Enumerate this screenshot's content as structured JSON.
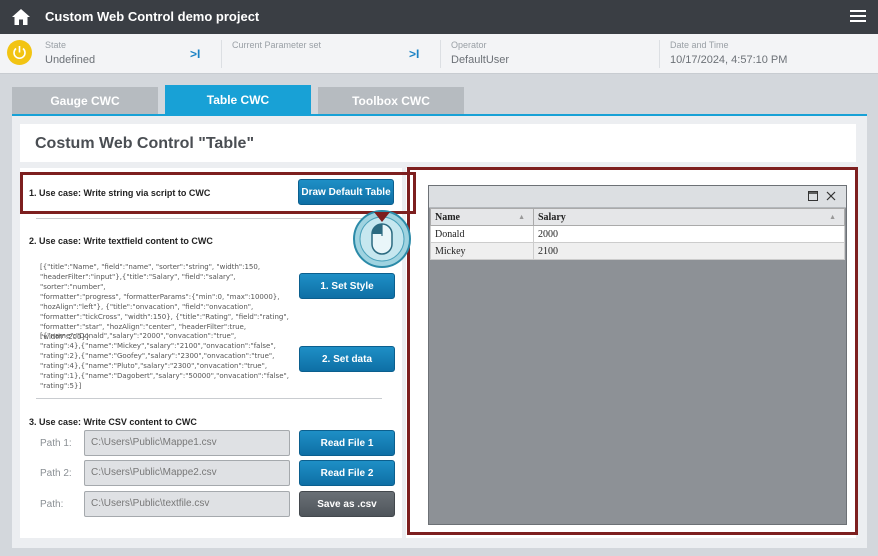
{
  "titlebar": {
    "title": "Custom Web Control demo project"
  },
  "status": {
    "state_label": "State",
    "state_value": "Undefined",
    "param_label": "Current Parameter set",
    "param_value": "",
    "operator_label": "Operator",
    "operator_value": "DefaultUser",
    "datetime_label": "Date and Time",
    "datetime_value": "10/17/2024, 4:57:10 PM",
    "arrow_symbol": ">I"
  },
  "tabs": [
    {
      "label": "Gauge CWC"
    },
    {
      "label": "Table CWC"
    },
    {
      "label": "Toolbox CWC"
    }
  ],
  "page": {
    "title": "Costum Web Control \"Table\""
  },
  "usecase1": {
    "label": "1. Use case: Write string via script to CWC",
    "button": "Draw Default Table"
  },
  "usecase2": {
    "label": "2. Use case: Write textfield content to CWC",
    "style_text": "[{\"title\":\"Name\", \"field\":\"name\", \"sorter\":\"string\", \"width\":150,\n\"headerFilter\":\"input\"},{\"title\":\"Salary\", \"field\":\"salary\", \"sorter\":\"number\",\n\"formatter\":\"progress\", \"formatterParams\":{\"min\":0, \"max\":10000},\n\"hozAlign\":\"left\"}, {\"title\":\"onvacation\", \"field\":\"onvacation\",\n\"formatter\":\"tickCross\", \"width\":150}, {\"title\":\"Rating\", \"field\":\"rating\",\n\"formatter\":\"star\", \"hozAlign\":\"center\", \"headerFilter\":true, \"width\":200}]",
    "style_button": "1. Set Style",
    "data_text": "[{\"name\":\"Donald\",\"salary\":\"2000\",\"onvacation\":\"true\",\n\"rating\":4},{\"name\":\"Mickey\",\"salary\":\"2100\",\"onvacation\":\"false\",\n\"rating\":2},{\"name\":\"Goofey\",\"salary\":\"2300\",\"onvacation\":\"true\",\n\"rating\":4},{\"name\":\"Pluto\",\"salary\":\"2300\",\"onvacation\":\"true\",\n\"rating\":1},{\"name\":\"Dagobert\",\"salary\":\"50000\",\"onvacation\":\"false\",\n\"rating\":5}]",
    "data_button": "2. Set data"
  },
  "usecase3": {
    "label": "3. Use case: Write CSV content to CWC",
    "rows": [
      {
        "label": "Path 1:",
        "value": "C:\\Users\\Public\\Mappe1.csv",
        "button": "Read File 1"
      },
      {
        "label": "Path 2:",
        "value": "C:\\Users\\Public\\Mappe2.csv",
        "button": "Read File 2"
      },
      {
        "label": "Path:",
        "value": "C:\\Users\\Public\\textfile.csv",
        "button": "Save as .csv"
      }
    ]
  },
  "table": {
    "columns": [
      "Name",
      "Salary"
    ],
    "rows": [
      [
        "Donald",
        "2000"
      ],
      [
        "Mickey",
        "2100"
      ]
    ]
  },
  "colors": {
    "accent": "#18a1d6",
    "highlight": "#7d1f1f",
    "power": "#f2c413"
  }
}
